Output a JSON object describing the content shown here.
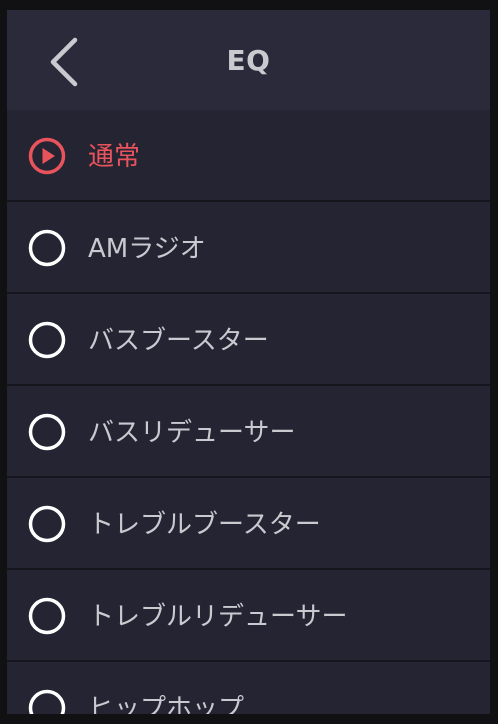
{
  "header": {
    "title": "EQ",
    "back_icon": "chevron-left-icon"
  },
  "colors": {
    "accent": "#e9545c",
    "text": "#c9c9d0",
    "background": "#252432",
    "header_background": "#2b2a3a"
  },
  "eq_presets": {
    "selected_index": 0,
    "items": [
      {
        "label": "通常",
        "selected": true
      },
      {
        "label": "AMラジオ",
        "selected": false
      },
      {
        "label": "バスブースター",
        "selected": false
      },
      {
        "label": "バスリデューサー",
        "selected": false
      },
      {
        "label": "トレブルブースター",
        "selected": false
      },
      {
        "label": "トレブルリデューサー",
        "selected": false
      },
      {
        "label": "ヒップホップ",
        "selected": false
      }
    ]
  }
}
